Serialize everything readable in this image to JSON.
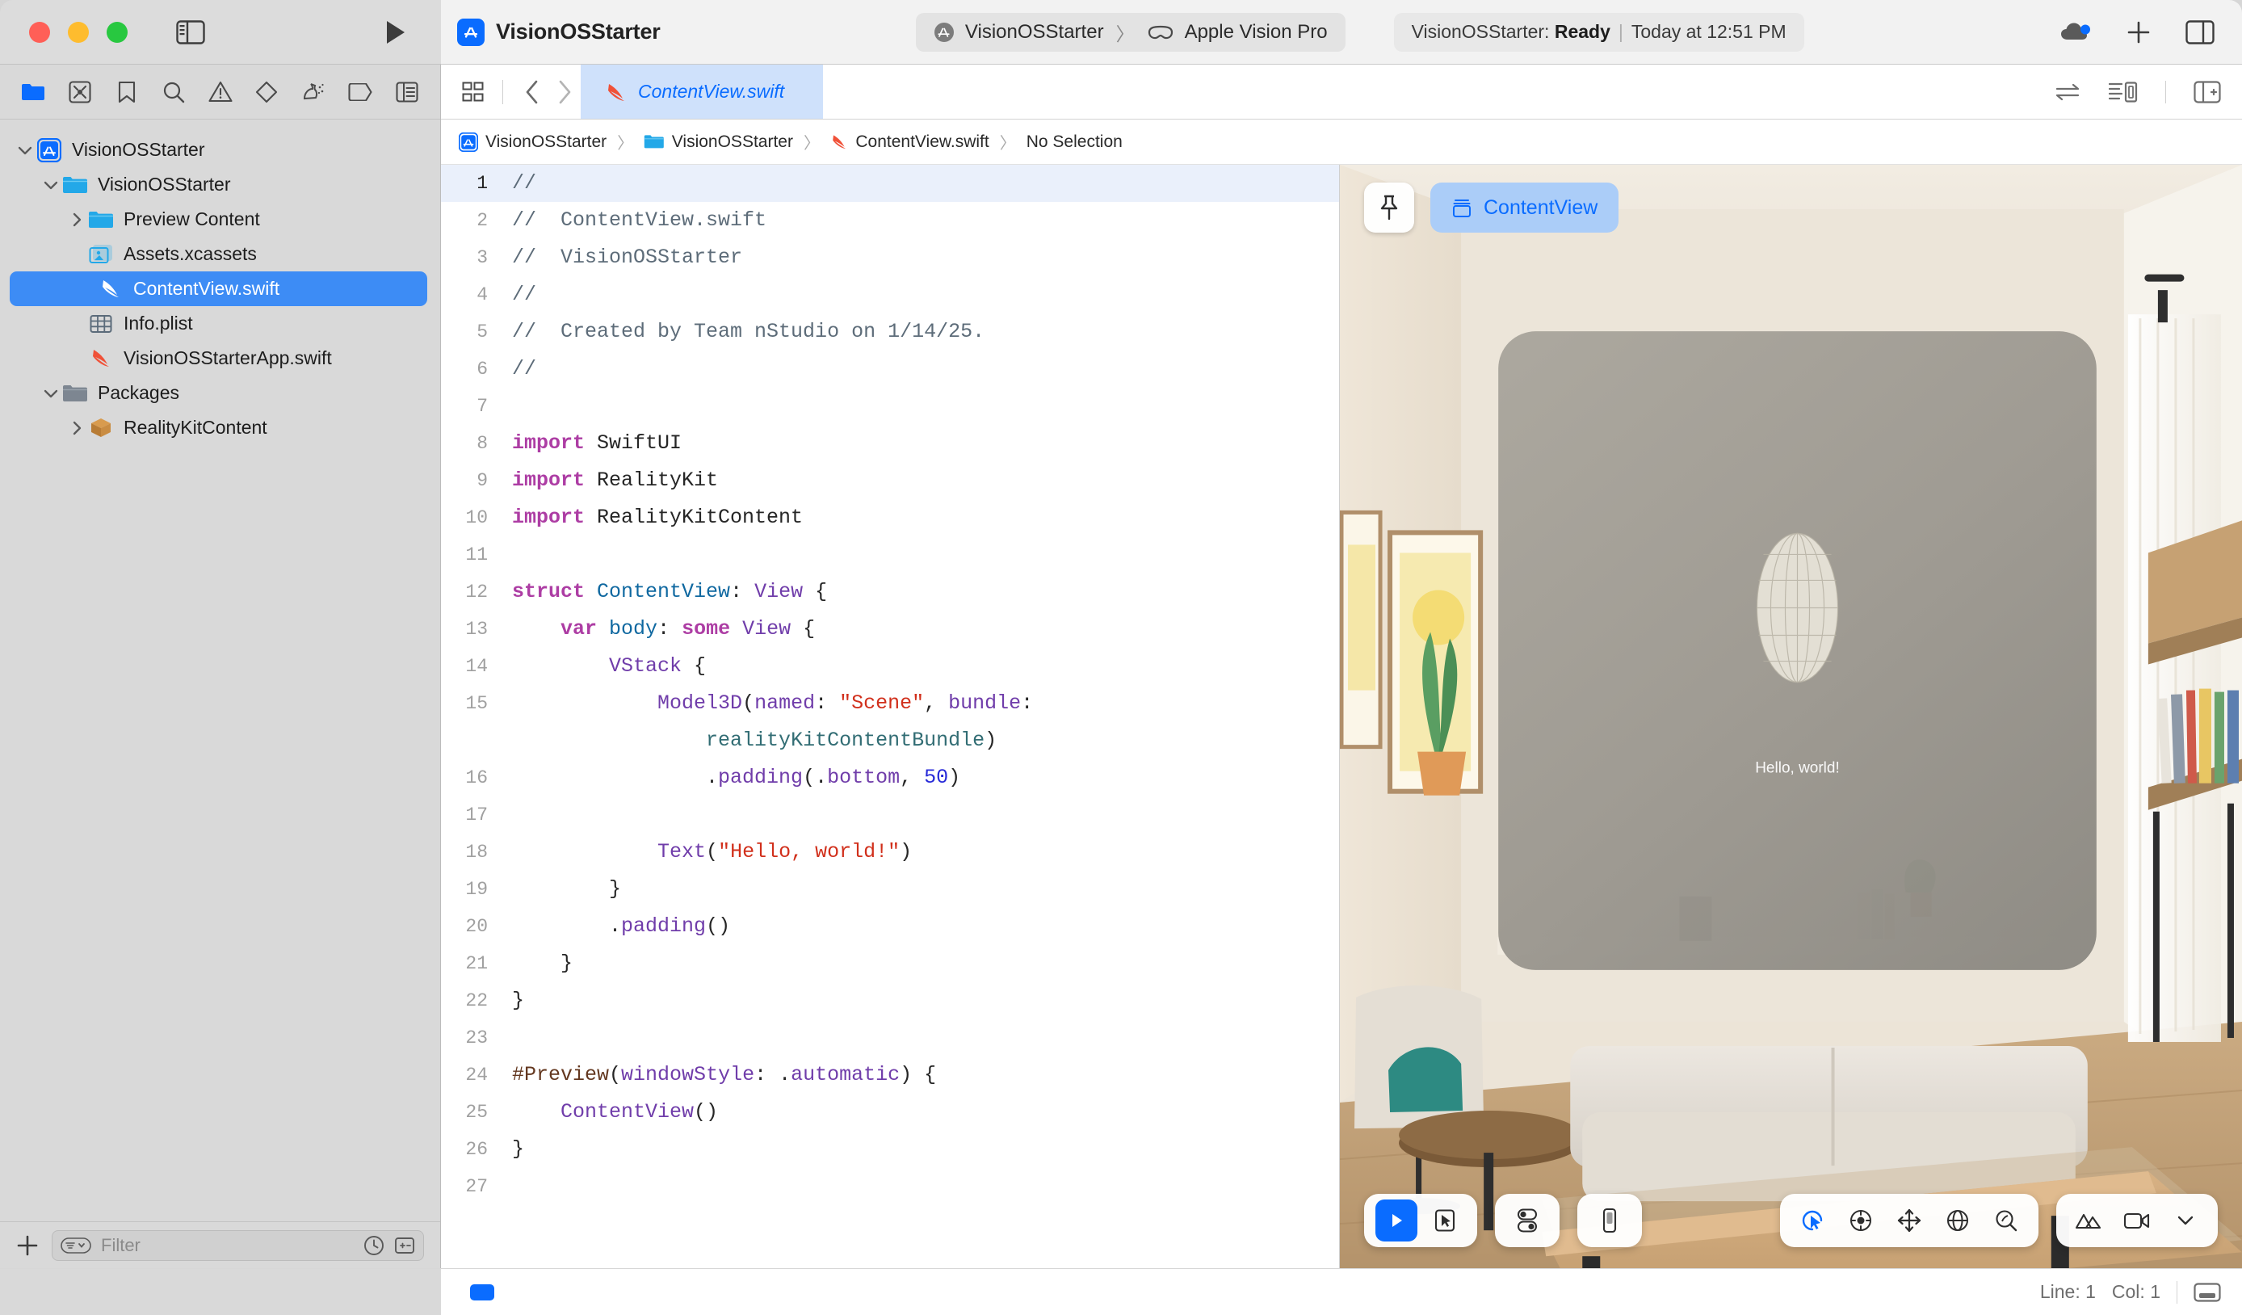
{
  "window": {
    "title": "VisionOSStarter",
    "traffic_lights": [
      "close",
      "minimize",
      "zoom"
    ]
  },
  "toolbar": {
    "scheme_name": "VisionOSStarter",
    "destination": "Apple Vision Pro",
    "scheme_separator": "〉",
    "status_project": "VisionOSStarter:",
    "status_state": "Ready",
    "status_separator": "|",
    "status_time": "Today at 12:51 PM",
    "add_label": "+",
    "icons": {
      "app_icon": "app-store-icon",
      "sidebar_toggle": "sidebar-toggle-icon",
      "run": "run-play-icon",
      "cloud": "cloud-status-icon",
      "add": "add-icon",
      "inspector_toggle": "inspector-toggle-icon"
    }
  },
  "navigator": {
    "icons": [
      {
        "name": "folder-icon",
        "label": "Project navigator",
        "active": true
      },
      {
        "name": "source-control-icon",
        "label": "Source control navigator",
        "active": false
      },
      {
        "name": "bookmark-icon",
        "label": "Bookmark navigator",
        "active": false
      },
      {
        "name": "search-icon",
        "label": "Find navigator",
        "active": false
      },
      {
        "name": "warning-triangle-icon",
        "label": "Issue navigator",
        "active": false
      },
      {
        "name": "test-diamond-icon",
        "label": "Test navigator",
        "active": false
      },
      {
        "name": "debug-spray-icon",
        "label": "Debug navigator",
        "active": false
      },
      {
        "name": "breakpoint-icon",
        "label": "Breakpoint navigator",
        "active": false
      },
      {
        "name": "report-icon",
        "label": "Report navigator",
        "active": false
      }
    ],
    "tree": [
      {
        "label": "VisionOSStarter",
        "indent": 0,
        "twisty": "down",
        "icon": "app-project-icon",
        "selected": false
      },
      {
        "label": "VisionOSStarter",
        "indent": 1,
        "twisty": "down",
        "icon": "folder-blue-icon",
        "selected": false
      },
      {
        "label": "Preview Content",
        "indent": 2,
        "twisty": "right",
        "icon": "folder-blue-icon",
        "selected": false
      },
      {
        "label": "Assets.xcassets",
        "indent": 2,
        "twisty": "none",
        "icon": "assets-icon",
        "selected": false
      },
      {
        "label": "ContentView.swift",
        "indent": 2,
        "twisty": "none",
        "icon": "swift-file-white-icon",
        "selected": true
      },
      {
        "label": "Info.plist",
        "indent": 2,
        "twisty": "none",
        "icon": "plist-table-icon",
        "selected": false
      },
      {
        "label": "VisionOSStarterApp.swift",
        "indent": 2,
        "twisty": "none",
        "icon": "swift-file-icon",
        "selected": false
      },
      {
        "label": "Packages",
        "indent": 1,
        "twisty": "down",
        "icon": "folder-gray-icon",
        "selected": false
      },
      {
        "label": "RealityKitContent",
        "indent": 2,
        "twisty": "right",
        "icon": "package-icon",
        "selected": false
      }
    ],
    "footer": {
      "add_label": "+",
      "filter_placeholder": "Filter",
      "filter_value": "",
      "icons": [
        "filter-dropdown-icon",
        "recent-clock-icon",
        "source-control-filter-icon"
      ]
    }
  },
  "editor": {
    "tab": {
      "label": "ContentView.swift",
      "icon": "swift-file-icon",
      "active": true
    },
    "tab_controls": [
      "grid-icon",
      "back-chevron-icon",
      "forward-chevron-icon"
    ],
    "right_controls": [
      "swap-arrows-icon",
      "editor-options-icon",
      "add-editor-icon"
    ],
    "breadcrumb": [
      {
        "label": "VisionOSStarter",
        "icon": "app-project-icon"
      },
      {
        "label": "VisionOSStarter",
        "icon": "folder-blue-icon"
      },
      {
        "label": "ContentView.swift",
        "icon": "swift-file-icon"
      },
      {
        "label": "No Selection",
        "icon": "none"
      }
    ],
    "breadcrumb_separator": "〉",
    "current_line": 1,
    "code_lines": [
      {
        "n": 1,
        "tokens": [
          {
            "t": "//",
            "c": "cmt"
          }
        ]
      },
      {
        "n": 2,
        "tokens": [
          {
            "t": "//  ContentView.swift",
            "c": "cmt"
          }
        ]
      },
      {
        "n": 3,
        "tokens": [
          {
            "t": "//  VisionOSStarter",
            "c": "cmt"
          }
        ]
      },
      {
        "n": 4,
        "tokens": [
          {
            "t": "//",
            "c": "cmt"
          }
        ]
      },
      {
        "n": 5,
        "tokens": [
          {
            "t": "//  Created by Team nStudio on 1/14/25.",
            "c": "cmt"
          }
        ]
      },
      {
        "n": 6,
        "tokens": [
          {
            "t": "//",
            "c": "cmt"
          }
        ]
      },
      {
        "n": 7,
        "tokens": []
      },
      {
        "n": 8,
        "tokens": [
          {
            "t": "import",
            "c": "kw"
          },
          {
            "t": " SwiftUI",
            "c": "pln"
          }
        ]
      },
      {
        "n": 9,
        "tokens": [
          {
            "t": "import",
            "c": "kw"
          },
          {
            "t": " RealityKit",
            "c": "pln"
          }
        ]
      },
      {
        "n": 10,
        "tokens": [
          {
            "t": "import",
            "c": "kw"
          },
          {
            "t": " RealityKitContent",
            "c": "pln"
          }
        ]
      },
      {
        "n": 11,
        "tokens": []
      },
      {
        "n": 12,
        "tokens": [
          {
            "t": "struct",
            "c": "kw"
          },
          {
            "t": " ",
            "c": "pln"
          },
          {
            "t": "ContentView",
            "c": "decl"
          },
          {
            "t": ": ",
            "c": "pln"
          },
          {
            "t": "View",
            "c": "typ"
          },
          {
            "t": " {",
            "c": "pln"
          }
        ]
      },
      {
        "n": 13,
        "tokens": [
          {
            "t": "    ",
            "c": "pln"
          },
          {
            "t": "var",
            "c": "kw"
          },
          {
            "t": " ",
            "c": "pln"
          },
          {
            "t": "body",
            "c": "decl"
          },
          {
            "t": ": ",
            "c": "pln"
          },
          {
            "t": "some",
            "c": "kw"
          },
          {
            "t": " ",
            "c": "pln"
          },
          {
            "t": "View",
            "c": "typ"
          },
          {
            "t": " {",
            "c": "pln"
          }
        ]
      },
      {
        "n": 14,
        "tokens": [
          {
            "t": "        ",
            "c": "pln"
          },
          {
            "t": "VStack",
            "c": "typ"
          },
          {
            "t": " {",
            "c": "pln"
          }
        ]
      },
      {
        "n": 15,
        "tokens": [
          {
            "t": "            ",
            "c": "pln"
          },
          {
            "t": "Model3D",
            "c": "typ"
          },
          {
            "t": "(",
            "c": "pln"
          },
          {
            "t": "named",
            "c": "typ"
          },
          {
            "t": ": ",
            "c": "pln"
          },
          {
            "t": "\"Scene\"",
            "c": "str"
          },
          {
            "t": ", ",
            "c": "pln"
          },
          {
            "t": "bundle",
            "c": "typ"
          },
          {
            "t": ":",
            "c": "pln"
          }
        ]
      },
      {
        "n": "",
        "tokens": [
          {
            "t": "                ",
            "c": "pln"
          },
          {
            "t": "realityKitContentBundle",
            "c": "glob"
          },
          {
            "t": ")",
            "c": "pln"
          }
        ],
        "wrapped": true
      },
      {
        "n": 16,
        "tokens": [
          {
            "t": "                .",
            "c": "pln"
          },
          {
            "t": "padding",
            "c": "typ"
          },
          {
            "t": "(.",
            "c": "pln"
          },
          {
            "t": "bottom",
            "c": "typ"
          },
          {
            "t": ", ",
            "c": "pln"
          },
          {
            "t": "50",
            "c": "num"
          },
          {
            "t": ")",
            "c": "pln"
          }
        ]
      },
      {
        "n": 17,
        "tokens": []
      },
      {
        "n": 18,
        "tokens": [
          {
            "t": "            ",
            "c": "pln"
          },
          {
            "t": "Text",
            "c": "typ"
          },
          {
            "t": "(",
            "c": "pln"
          },
          {
            "t": "\"Hello, world!\"",
            "c": "str"
          },
          {
            "t": ")",
            "c": "pln"
          }
        ]
      },
      {
        "n": 19,
        "tokens": [
          {
            "t": "        }",
            "c": "pln"
          }
        ]
      },
      {
        "n": 20,
        "tokens": [
          {
            "t": "        .",
            "c": "pln"
          },
          {
            "t": "padding",
            "c": "typ"
          },
          {
            "t": "()",
            "c": "pln"
          }
        ]
      },
      {
        "n": 21,
        "tokens": [
          {
            "t": "    }",
            "c": "pln"
          }
        ]
      },
      {
        "n": 22,
        "tokens": [
          {
            "t": "}",
            "c": "pln"
          }
        ]
      },
      {
        "n": 23,
        "tokens": []
      },
      {
        "n": 24,
        "tokens": [
          {
            "t": "#Preview",
            "c": "prep"
          },
          {
            "t": "(",
            "c": "pln"
          },
          {
            "t": "windowStyle",
            "c": "typ"
          },
          {
            "t": ": .",
            "c": "pln"
          },
          {
            "t": "automatic",
            "c": "typ"
          },
          {
            "t": ") {",
            "c": "pln"
          }
        ]
      },
      {
        "n": 25,
        "tokens": [
          {
            "t": "    ",
            "c": "pln"
          },
          {
            "t": "ContentView",
            "c": "typ"
          },
          {
            "t": "()",
            "c": "pln"
          }
        ]
      },
      {
        "n": 26,
        "tokens": [
          {
            "t": "}",
            "c": "pln"
          }
        ]
      },
      {
        "n": 27,
        "tokens": []
      }
    ]
  },
  "preview": {
    "pin_icon": "pin-icon",
    "chip_label": "ContentView",
    "chip_icon": "window-stack-icon",
    "window_text": "Hello, world!",
    "controls_left": [
      {
        "name": "live-preview-play-icon",
        "active": true
      },
      {
        "name": "selectable-pointer-icon",
        "active": false
      }
    ],
    "controls_variants": [
      {
        "name": "appearance-variants-icon",
        "active": false
      }
    ],
    "controls_device": [
      {
        "name": "device-settings-icon",
        "active": false
      }
    ],
    "controls_camera": [
      {
        "name": "orbit-pointer-icon",
        "active": true
      },
      {
        "name": "orbit-icon",
        "active": false
      },
      {
        "name": "pan-move-icon",
        "active": false
      },
      {
        "name": "rotate-globe-icon",
        "active": false
      },
      {
        "name": "zoom-magnifier-icon",
        "active": false
      }
    ],
    "controls_scene": [
      {
        "name": "environment-mountains-icon",
        "active": false
      },
      {
        "name": "camera-video-icon",
        "active": false
      },
      {
        "name": "chevron-down-icon",
        "active": false
      }
    ]
  },
  "statusbar": {
    "line_label": "Line: 1",
    "col_label": "Col: 1",
    "console_icon": "console-toggle-icon"
  },
  "colors": {
    "accent_blue": "#0a6cff",
    "selection_blue": "#3d8cf5",
    "tab_active_bg": "#cfe1fb",
    "keyword": "#ad3da4",
    "type": "#703daa",
    "declaration": "#0f68a0",
    "global": "#326d74",
    "string": "#d12f1b",
    "number": "#272ad8",
    "comment": "#5d6c79",
    "preprocessor": "#643820",
    "chrome_gray": "#d9d9d9"
  }
}
